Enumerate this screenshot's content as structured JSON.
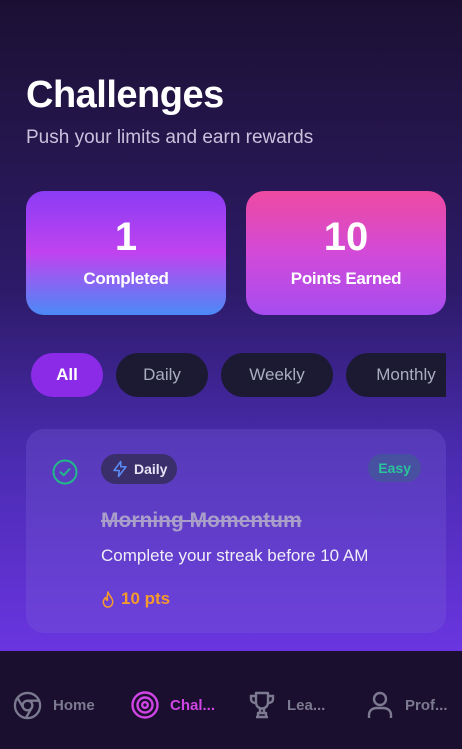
{
  "header": {
    "title": "Challenges",
    "subtitle": "Push your limits and earn rewards"
  },
  "stats": [
    {
      "value": "1",
      "label": "Completed"
    },
    {
      "value": "10",
      "label": "Points Earned"
    }
  ],
  "filters": [
    {
      "label": "All",
      "active": true
    },
    {
      "label": "Daily",
      "active": false
    },
    {
      "label": "Weekly",
      "active": false
    },
    {
      "label": "Monthly",
      "active": false
    }
  ],
  "challenge": {
    "category": "Daily",
    "difficulty": "Easy",
    "title": "Morning Momentum",
    "description": "Complete your streak before 10 AM",
    "points": "10 pts",
    "completed": true
  },
  "tabbar": {
    "items": [
      {
        "label": "Home",
        "icon": "chrome-icon",
        "active": false
      },
      {
        "label": "Chal...",
        "icon": "target-icon",
        "active": true
      },
      {
        "label": "Lea...",
        "icon": "trophy-icon",
        "active": false
      },
      {
        "label": "Prof...",
        "icon": "user-icon",
        "active": false
      }
    ]
  },
  "colors": {
    "accent": "#8b2be8",
    "active_tab": "#d044e6",
    "easy": "#2bc39a",
    "points": "#f59a2c"
  }
}
